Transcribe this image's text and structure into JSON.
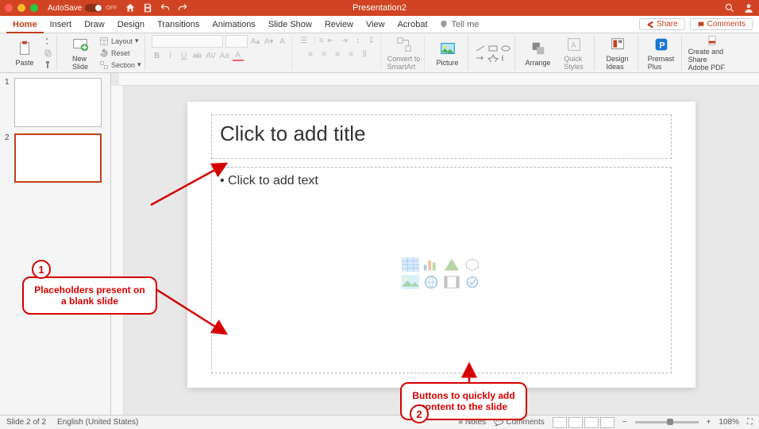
{
  "title_bar": {
    "autosave_label": "AutoSave",
    "autosave_state": "OFF",
    "doc_title": "Presentation2"
  },
  "tabs": [
    "Home",
    "Insert",
    "Draw",
    "Design",
    "Transitions",
    "Animations",
    "Slide Show",
    "Review",
    "View",
    "Acrobat"
  ],
  "active_tab": "Home",
  "tell_me": "Tell me",
  "share_label": "Share",
  "comments_label": "Comments",
  "ribbon": {
    "paste": "Paste",
    "new_slide": "New\nSlide",
    "layout": "Layout",
    "reset": "Reset",
    "section": "Section",
    "convert": "Convert to\nSmartArt",
    "picture": "Picture",
    "arrange": "Arrange",
    "quick_styles": "Quick\nStyles",
    "design_ideas": "Design\nIdeas",
    "premast": "Premast\nPlus",
    "create_share": "Create and Share\nAdobe PDF"
  },
  "slide_panel": {
    "thumbs": [
      {
        "num": "1",
        "selected": false
      },
      {
        "num": "2",
        "selected": true
      }
    ]
  },
  "slide": {
    "title_placeholder": "Click to add title",
    "body_placeholder": "• Click to add text"
  },
  "annotations": {
    "a1_num": "1",
    "a1_text": "Placeholders present on a blank slide",
    "a2_num": "2",
    "a2_text": "Buttons to quickly add content to the slide"
  },
  "status": {
    "slide_info": "Slide 2 of 2",
    "language": "English (United States)",
    "notes": "Notes",
    "comments": "Comments",
    "zoom": "108%"
  }
}
